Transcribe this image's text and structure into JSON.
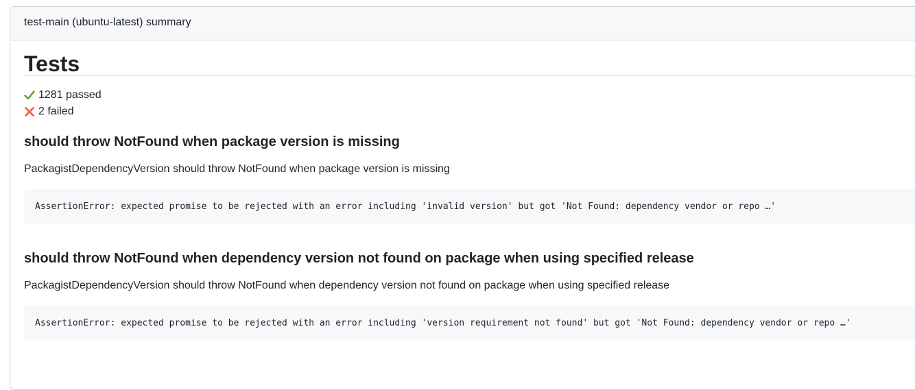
{
  "summary": {
    "header_title": "test-main (ubuntu-latest) summary",
    "heading": "Tests",
    "passed_text": "1281 passed",
    "failed_text": "2 failed",
    "passed_icon": "check-mark-icon",
    "failed_icon": "cross-mark-icon",
    "colors": {
      "pass": "#5fa83b",
      "fail": "#f26b3a",
      "code_bg": "#f6f8fa",
      "border": "#d0d7de"
    }
  },
  "failures": [
    {
      "title": "should throw NotFound when package version is missing",
      "description": "PackagistDependencyVersion should throw NotFound when package version is missing",
      "error": "AssertionError: expected promise to be rejected with an error including 'invalid version' but got 'Not Found: dependency vendor or repo …'"
    },
    {
      "title": "should throw NotFound when dependency version not found on package when using specified release",
      "description": "PackagistDependencyVersion should throw NotFound when dependency version not found on package when using specified release",
      "error": "AssertionError: expected promise to be rejected with an error including 'version requirement not found' but got 'Not Found: dependency vendor or repo …'"
    }
  ]
}
